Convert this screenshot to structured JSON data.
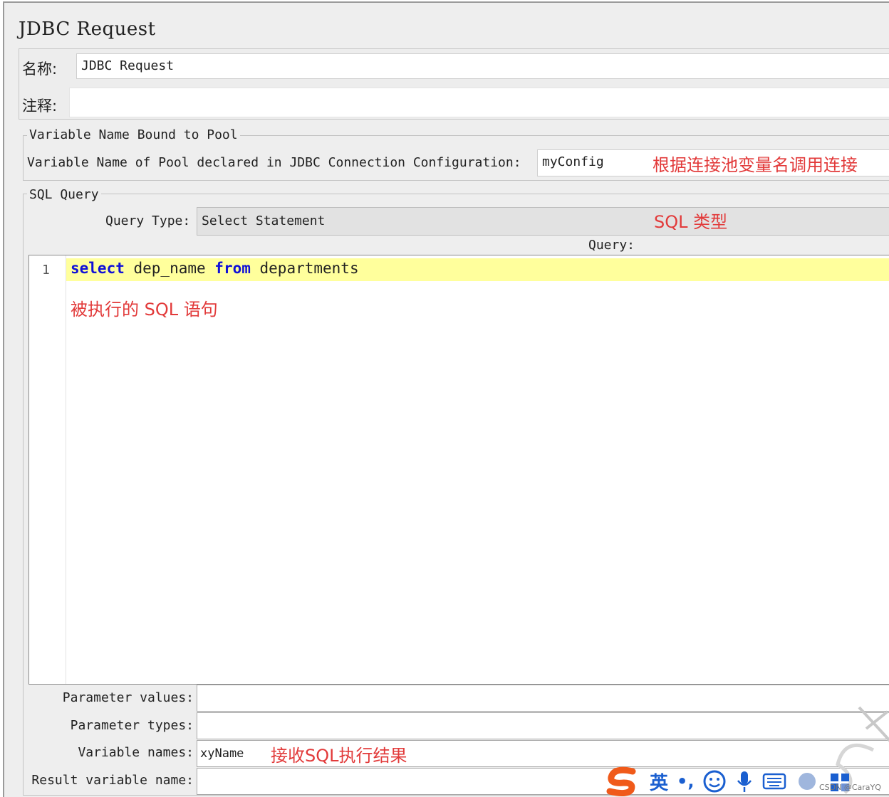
{
  "window": {
    "title": "JDBC Request"
  },
  "name_section": {
    "name_label": "名称:",
    "name_value": "JDBC Request",
    "comment_label": "注释:",
    "comment_value": ""
  },
  "pool_section": {
    "legend": "Variable Name Bound to Pool",
    "label": "Variable Name of Pool declared in JDBC Connection Configuration:",
    "value": "myConfig",
    "annotation": "根据连接池变量名调用连接"
  },
  "sql_section": {
    "legend": "SQL Query",
    "query_type_label": "Query Type:",
    "query_type_value": "Select Statement",
    "query_type_annotation": "SQL 类型",
    "query_label": "Query:",
    "line_number": "1",
    "code_kw1": "select",
    "code_text1": " dep_name ",
    "code_kw2": "from",
    "code_text2": " departments",
    "query_annotation": "被执行的 SQL 语句"
  },
  "params": {
    "parameter_values_label": "Parameter values:",
    "parameter_values_value": "",
    "parameter_types_label": "Parameter types:",
    "parameter_types_value": "",
    "variable_names_label": "Variable names:",
    "variable_names_value": "xyName",
    "variable_names_annotation": "接收SQL执行结果",
    "result_variable_label": "Result variable name:",
    "result_variable_value": ""
  },
  "ime_toolbar": {
    "lang": "英",
    "punct": "•,",
    "logo_icon": "sogou-s-icon"
  },
  "watermark": "CSDN @CaraYQ",
  "colors": {
    "annotation": "#e23a3a",
    "keyword": "#1010d8",
    "highlight": "#ffff9c",
    "ime_orange": "#f05a1a",
    "ime_blue": "#1a5fd0"
  }
}
